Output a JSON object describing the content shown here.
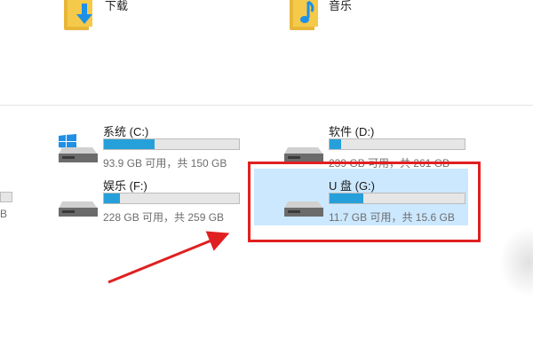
{
  "folders": [
    {
      "label": "下载",
      "icon": "downloads-folder-icon"
    },
    {
      "label": "音乐",
      "icon": "music-folder-icon"
    }
  ],
  "drives": [
    {
      "name": "系统 (C:)",
      "space": "93.9 GB 可用，共 150 GB",
      "used_fraction": 0.374
    },
    {
      "name": "软件 (D:)",
      "space": "239 GB 可用，共 261 GB",
      "used_fraction": 0.084
    },
    {
      "name": "娱乐 (F:)",
      "space": "228 GB 可用，共 259 GB",
      "used_fraction": 0.12
    },
    {
      "name": "U 盘 (G:)",
      "space": "11.7 GB 可用，共 15.6 GB",
      "used_fraction": 0.25,
      "selected": true
    }
  ],
  "partial_left_text": "B",
  "colors": {
    "progress_fill": "#26a0da",
    "selection": "#cce8ff",
    "annotation_red": "#e02020",
    "folder_yellow": "#f5c94a",
    "icon_blue": "#1e90e6"
  }
}
